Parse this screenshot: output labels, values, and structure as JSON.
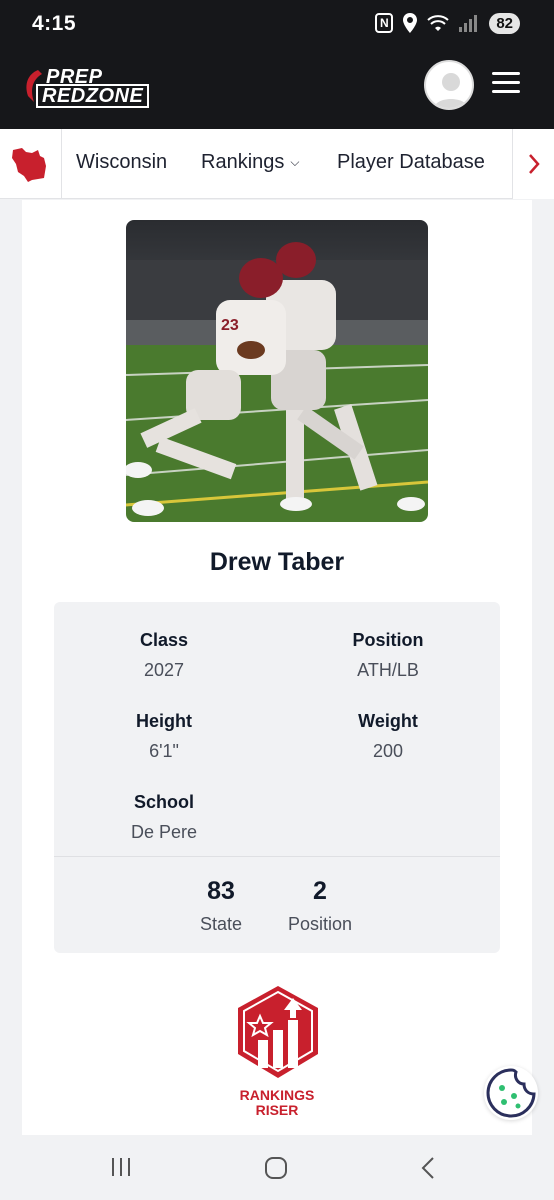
{
  "status_bar": {
    "time": "4:15",
    "battery": "82",
    "icons": [
      "nfc-icon",
      "location-icon",
      "wifi-icon",
      "signal-icon"
    ]
  },
  "header": {
    "logo_line1": "PREP",
    "logo_line2": "REDZONE",
    "icons": [
      "avatar",
      "menu-icon"
    ]
  },
  "sub_nav": {
    "state_icon": "wisconsin-map-icon",
    "items": [
      {
        "label": "Wisconsin"
      },
      {
        "label": "Rankings",
        "has_dropdown": true
      },
      {
        "label": "Player Database"
      }
    ],
    "next_icon": "chevron-right-icon"
  },
  "player": {
    "name": "Drew Taber",
    "photo": "player-action-photo",
    "details": {
      "class_label": "Class",
      "class_value": "2027",
      "position_label": "Position",
      "position_value": "ATH/LB",
      "height_label": "Height",
      "height_value": "6'1\"",
      "weight_label": "Weight",
      "weight_value": "200",
      "school_label": "School",
      "school_value": "De Pere"
    },
    "rankings": {
      "state_rank": "83",
      "state_label": "State",
      "position_rank": "2",
      "position_label": "Position"
    },
    "badge": {
      "line1": "RANKINGS",
      "line2": "RISER",
      "icon": "rankings-riser-badge-icon"
    }
  },
  "colors": {
    "brand_red": "#c8202d",
    "header_bg": "#16171a",
    "text_dark": "#111a2a",
    "text_muted": "#4a4f5a"
  },
  "android_nav": {
    "icons": [
      "recent-apps-icon",
      "home-icon",
      "back-icon"
    ]
  }
}
